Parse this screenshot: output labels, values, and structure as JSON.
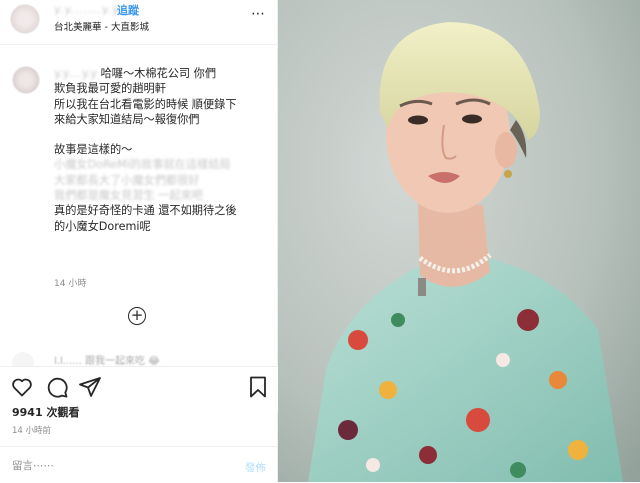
{
  "header": {
    "username": "y.y.......y.y",
    "follow_label": "追蹤",
    "location": "台北美麗華 - 大直影城",
    "more_icon": "⋯"
  },
  "caption": {
    "username": "y.y....y.y",
    "lines": [
      "哈囉～木棉花公司 你們",
      "欺負我最可愛的趙明軒",
      "所以我在台北看電影的時候 順便錄下",
      "來給大家知道結局～報復你們",
      "",
      "故事是這樣的～",
      "小魔女DoReMi的故事就在這樣結局",
      "大家都長大了小魔女們都很好",
      "我們都是魔女見習生 一起來吧",
      "真的是好奇怪的卡通 還不如期待之後",
      "的小魔女Doremi呢"
    ],
    "time": "14 小時"
  },
  "reply_preview": "l.l...... 跟我一起來吃 😂",
  "actions": {
    "views": "9941 次觀看",
    "time": "14 小時前"
  },
  "comment": {
    "placeholder": "留言⋯⋯",
    "post_label": "發佈"
  },
  "colors": {
    "follow": "#3897f0",
    "post_disabled": "#b2dffc",
    "muted": "#8e8e8e"
  }
}
